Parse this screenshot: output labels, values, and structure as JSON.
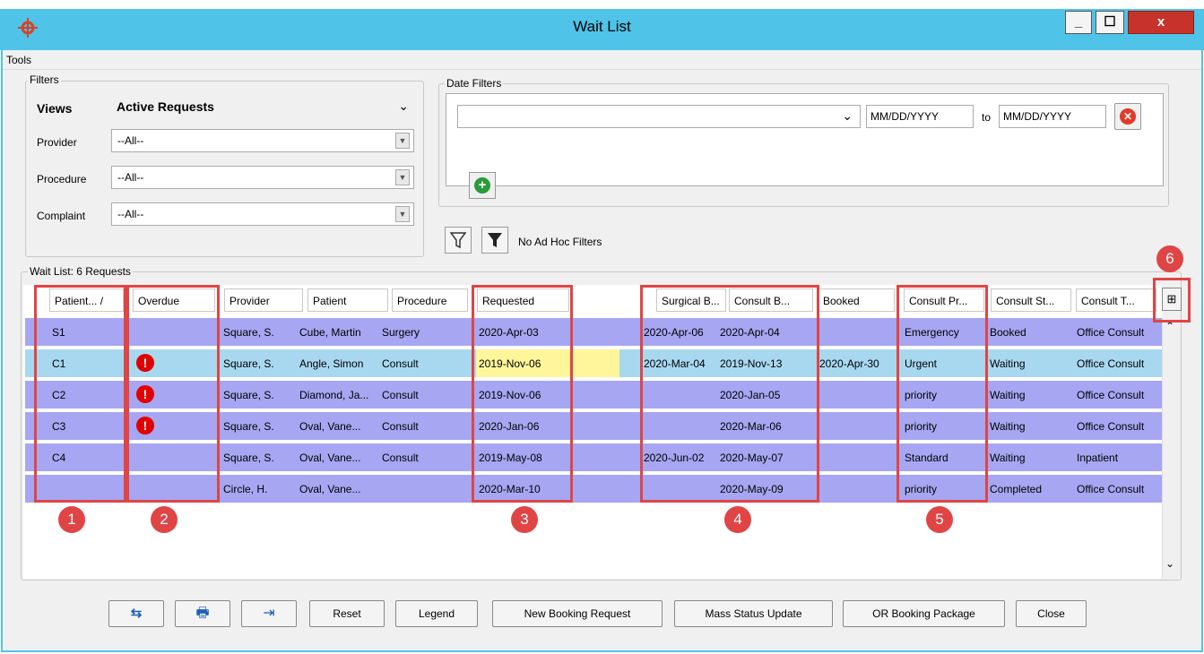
{
  "window": {
    "title": "Wait List"
  },
  "menu": {
    "tools": "Tools"
  },
  "filters": {
    "group_label": "Filters",
    "views_label": "Views",
    "views_value": "Active Requests",
    "provider_label": "Provider",
    "provider_value": "--All--",
    "procedure_label": "Procedure",
    "procedure_value": "--All--",
    "complaint_label": "Complaint",
    "complaint_value": "--All--"
  },
  "date_filters": {
    "group_label": "Date Filters",
    "from_placeholder": "MM/DD/YYYY",
    "to_label": "to",
    "to_placeholder": "MM/DD/YYYY"
  },
  "adhoc": {
    "label": "No Ad Hoc Filters"
  },
  "waitlist": {
    "label": "Wait List: 6 Requests",
    "columns": [
      "Patient... /",
      "Overdue",
      "Provider",
      "Patient",
      "Procedure",
      "Requested",
      "Surgical B...",
      "Consult B...",
      "Booked",
      "Consult Pr...",
      "Consult St...",
      "Consult T..."
    ],
    "rows": [
      {
        "id": "S1",
        "overdue": false,
        "provider": "Square, S.",
        "patient": "Cube, Martin",
        "procedure": "Surgery",
        "requested": "2020-Apr-03",
        "surgical": "2020-Apr-06",
        "consult": "2020-Apr-04",
        "booked": "",
        "priority": "Emergency",
        "status": "Booked",
        "type": "Office Consult"
      },
      {
        "id": "C1",
        "overdue": true,
        "provider": "Square, S.",
        "patient": "Angle, Simon",
        "procedure": "Consult",
        "requested": "2019-Nov-06",
        "surgical": "2020-Mar-04",
        "consult": "2019-Nov-13",
        "booked": "2020-Apr-30",
        "priority": "Urgent",
        "status": "Waiting",
        "type": "Office Consult"
      },
      {
        "id": "C2",
        "overdue": true,
        "provider": "Square, S.",
        "patient": "Diamond, Ja...",
        "procedure": "Consult",
        "requested": "2019-Nov-06",
        "surgical": "",
        "consult": "2020-Jan-05",
        "booked": "",
        "priority": "priority",
        "status": "Waiting",
        "type": "Office Consult"
      },
      {
        "id": "C3",
        "overdue": true,
        "provider": "Square, S.",
        "patient": "Oval, Vane...",
        "procedure": "Consult",
        "requested": "2020-Jan-06",
        "surgical": "",
        "consult": "2020-Mar-06",
        "booked": "",
        "priority": "priority",
        "status": "Waiting",
        "type": "Office Consult"
      },
      {
        "id": "C4",
        "overdue": false,
        "provider": "Square, S.",
        "patient": "Oval, Vane...",
        "procedure": "Consult",
        "requested": "2019-May-08",
        "surgical": "2020-Jun-02",
        "consult": "2020-May-07",
        "booked": "",
        "priority": "Standard",
        "status": "Waiting",
        "type": "Inpatient"
      },
      {
        "id": "",
        "overdue": false,
        "provider": "Circle, H.",
        "patient": "Oval, Vane...",
        "procedure": "",
        "requested": "2020-Mar-10",
        "surgical": "",
        "consult": "2020-May-09",
        "booked": "",
        "priority": "priority",
        "status": "Completed",
        "type": "Office Consult"
      }
    ]
  },
  "badges": [
    "1",
    "2",
    "3",
    "4",
    "5",
    "6"
  ],
  "buttons": {
    "reset": "Reset",
    "legend": "Legend",
    "new_booking": "New Booking Request",
    "mass_status": "Mass Status Update",
    "or_package": "OR Booking Package",
    "close": "Close"
  },
  "colors": {
    "titlebar": "#4fc3e8",
    "row": "#a6a6f2",
    "row_selected": "#a8d8f0",
    "highlight": "#fff59a",
    "annotation": "#e04545"
  }
}
